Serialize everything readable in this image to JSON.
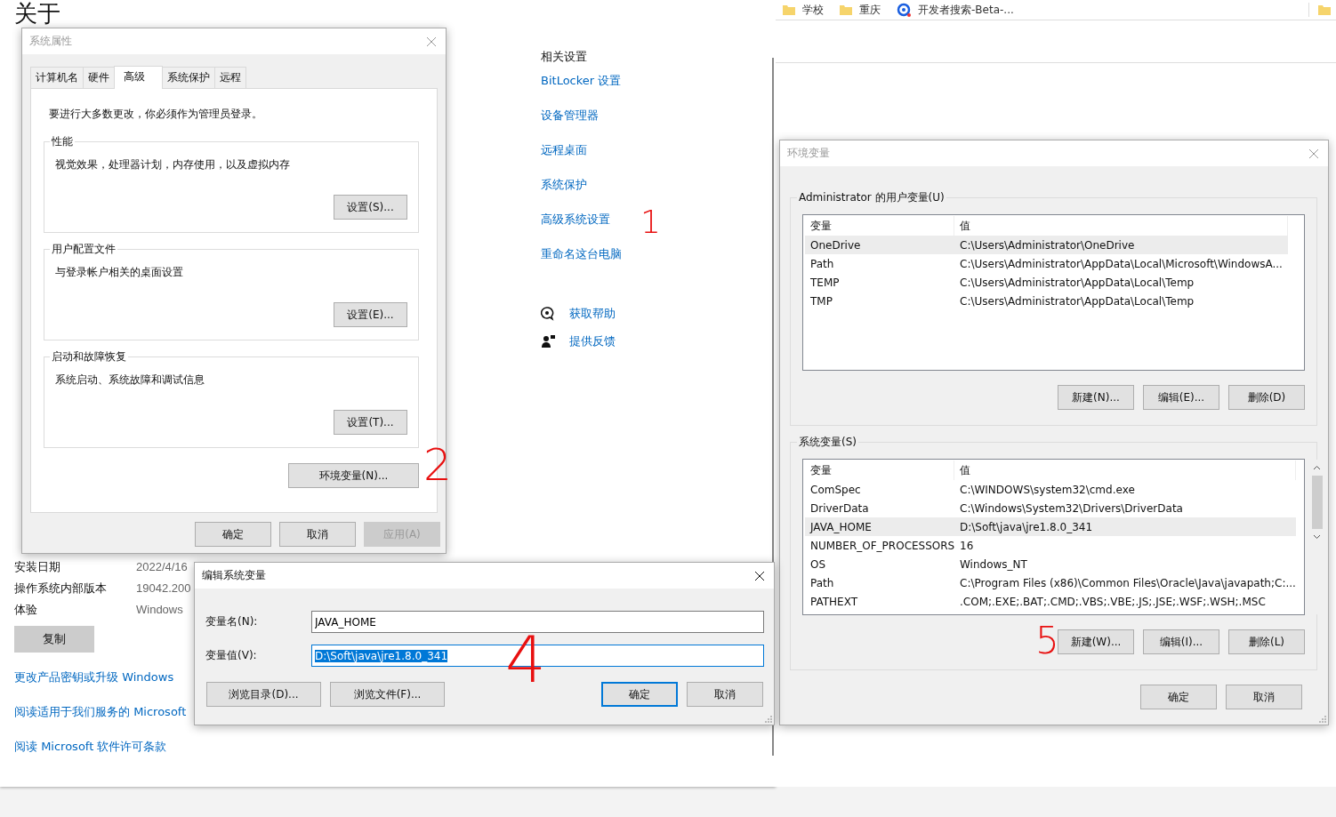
{
  "settings_page": {
    "title": "关于",
    "rows": [
      {
        "label": "安装日期",
        "value": "2022/4/16"
      },
      {
        "label": "操作系统内部版本",
        "value": "19042.200"
      },
      {
        "label": "体验",
        "value": "Windows"
      }
    ],
    "copy_button": "复制",
    "links": [
      "更改产品密钥或升级 Windows",
      "阅读适用于我们服务的 Microsoft",
      "阅读 Microsoft 软件许可条款"
    ],
    "related": {
      "heading": "相关设置",
      "links": [
        "BitLocker 设置",
        "设备管理器",
        "远程桌面",
        "系统保护",
        "高级系统设置",
        "重命名这台电脑"
      ]
    },
    "help": [
      {
        "kind": "help",
        "label": "获取帮助"
      },
      {
        "kind": "feedback",
        "label": "提供反馈"
      }
    ]
  },
  "browser": {
    "bookmarks": [
      {
        "kind": "folder",
        "label": "学校"
      },
      {
        "kind": "folder",
        "label": "重庆"
      },
      {
        "kind": "site",
        "label": "开发者搜索-Beta-..."
      }
    ]
  },
  "system_properties": {
    "title": "系统属性",
    "active": false,
    "tabs": [
      {
        "label": "计算机名",
        "selected": false
      },
      {
        "label": "硬件",
        "selected": false
      },
      {
        "label": "高级",
        "selected": true
      },
      {
        "label": "系统保护",
        "selected": false
      },
      {
        "label": "远程",
        "selected": false
      }
    ],
    "notice": "要进行大多数更改，你必须作为管理员登录。",
    "groups": [
      {
        "title": "性能",
        "text": "视觉效果，处理器计划，内存使用，以及虚拟内存",
        "button": "设置(S)..."
      },
      {
        "title": "用户配置文件",
        "text": "与登录帐户相关的桌面设置",
        "button": "设置(E)..."
      },
      {
        "title": "启动和故障恢复",
        "text": "系统启动、系统故障和调试信息",
        "button": "设置(T)..."
      }
    ],
    "env_button": "环境变量(N)...",
    "buttons": [
      {
        "label": "确定",
        "disabled": false
      },
      {
        "label": "取消",
        "disabled": false
      },
      {
        "label": "应用(A)",
        "disabled": true
      }
    ]
  },
  "environment_variables": {
    "title": "环境变量",
    "active": false,
    "user": {
      "title": "Administrator 的用户变量(U)",
      "columns": [
        "变量",
        "值"
      ],
      "rows": [
        {
          "name": "OneDrive",
          "value": "C:\\Users\\Administrator\\OneDrive",
          "selected": true
        },
        {
          "name": "Path",
          "value": "C:\\Users\\Administrator\\AppData\\Local\\Microsoft\\WindowsA...",
          "selected": false
        },
        {
          "name": "TEMP",
          "value": "C:\\Users\\Administrator\\AppData\\Local\\Temp",
          "selected": false
        },
        {
          "name": "TMP",
          "value": "C:\\Users\\Administrator\\AppData\\Local\\Temp",
          "selected": false
        }
      ],
      "buttons": [
        "新建(N)...",
        "编辑(E)...",
        "删除(D)"
      ]
    },
    "system": {
      "title": "系统变量(S)",
      "columns": [
        "变量",
        "值"
      ],
      "rows": [
        {
          "name": "ComSpec",
          "value": "C:\\WINDOWS\\system32\\cmd.exe",
          "selected": false
        },
        {
          "name": "DriverData",
          "value": "C:\\Windows\\System32\\Drivers\\DriverData",
          "selected": false
        },
        {
          "name": "JAVA_HOME",
          "value": "D:\\Soft\\java\\jre1.8.0_341",
          "selected": true
        },
        {
          "name": "NUMBER_OF_PROCESSORS",
          "value": "16",
          "selected": false
        },
        {
          "name": "OS",
          "value": "Windows_NT",
          "selected": false
        },
        {
          "name": "Path",
          "value": "C:\\Program Files (x86)\\Common Files\\Oracle\\Java\\javapath;C:...",
          "selected": false
        },
        {
          "name": "PATHEXT",
          "value": ".COM;.EXE;.BAT;.CMD;.VBS;.VBE;.JS;.JSE;.WSF;.WSH;.MSC",
          "selected": false
        }
      ],
      "buttons": [
        "新建(W)...",
        "编辑(I)...",
        "删除(L)"
      ]
    },
    "buttons": [
      "确定",
      "取消"
    ]
  },
  "edit_dialog": {
    "title": "编辑系统变量",
    "active": true,
    "name_label": "变量名(N):",
    "name_value": "JAVA_HOME",
    "value_label": "变量值(V):",
    "value_value": "D:\\Soft\\java\\jre1.8.0_341",
    "value_selected": true,
    "browse_buttons": [
      "浏览目录(D)...",
      "浏览文件(F)..."
    ],
    "buttons": [
      {
        "label": "确定",
        "focused": true
      },
      {
        "label": "取消",
        "focused": false
      }
    ]
  },
  "annotations": [
    "1",
    "2",
    "4",
    "5"
  ]
}
